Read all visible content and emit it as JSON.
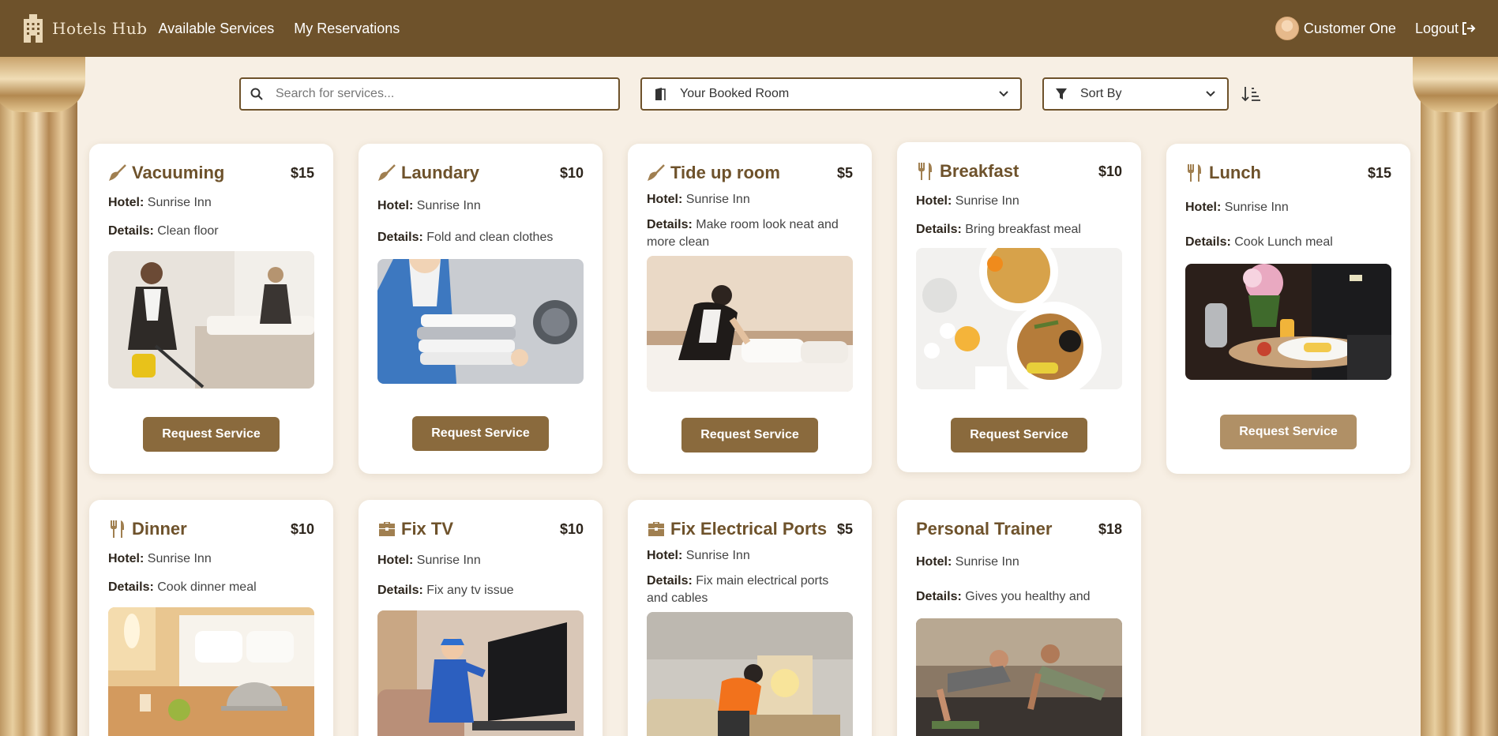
{
  "header": {
    "brand": "Hotels Hub",
    "nav": [
      "Available Services",
      "My Reservations"
    ],
    "user_name": "Customer One",
    "logout_label": "Logout"
  },
  "filters": {
    "search_placeholder": "Search for services...",
    "room_select": "Your Booked Room",
    "sort_select": "Sort By"
  },
  "labels": {
    "hotel": "Hotel:",
    "details": "Details:",
    "request": "Request Service"
  },
  "services": [
    {
      "title": "Vacuuming",
      "price": "$15",
      "hotel": "Sunrise Inn",
      "details": "Clean floor",
      "icon": "broom-icon",
      "image": "maid-vacuuming-room"
    },
    {
      "title": "Laundary",
      "price": "$10",
      "hotel": "Sunrise Inn",
      "details": "Fold and clean clothes",
      "icon": "broom-icon",
      "image": "woman-holding-folded-towels"
    },
    {
      "title": "Tide up room",
      "price": "$5",
      "hotel": "Sunrise Inn",
      "details": "Make room look neat and more clean",
      "icon": "broom-icon",
      "image": "maid-making-bed"
    },
    {
      "title": "Breakfast",
      "price": "$10",
      "hotel": "Sunrise Inn",
      "details": "Bring breakfast meal",
      "icon": "utensils-icon",
      "image": "breakfast-table"
    },
    {
      "title": "Lunch",
      "price": "$15",
      "hotel": "Sunrise Inn",
      "details": "Cook Lunch meal",
      "icon": "utensils-icon",
      "image": "waiter-serving-tray"
    },
    {
      "title": "Dinner",
      "price": "$10",
      "hotel": "Sunrise Inn",
      "details": "Cook dinner meal",
      "icon": "utensils-icon",
      "image": "dinner-cart-bedroom"
    },
    {
      "title": "Fix TV",
      "price": "$10",
      "hotel": "Sunrise Inn",
      "details": "Fix any tv issue",
      "icon": "toolbox-icon",
      "image": "technician-fixing-tv"
    },
    {
      "title": "Fix Electrical Ports",
      "price": "$5",
      "hotel": "Sunrise Inn",
      "details": "Fix main electrical ports and cables",
      "icon": "toolbox-icon",
      "image": "electrician-at-work"
    },
    {
      "title": "Personal Trainer",
      "price": "$18",
      "hotel": "Sunrise Inn",
      "details": "Gives you healthy and",
      "icon": "",
      "image": "people-doing-pushups"
    }
  ],
  "colors": {
    "header": "#6e522b",
    "accent": "#8a6a3d",
    "background": "#f7efe4"
  }
}
